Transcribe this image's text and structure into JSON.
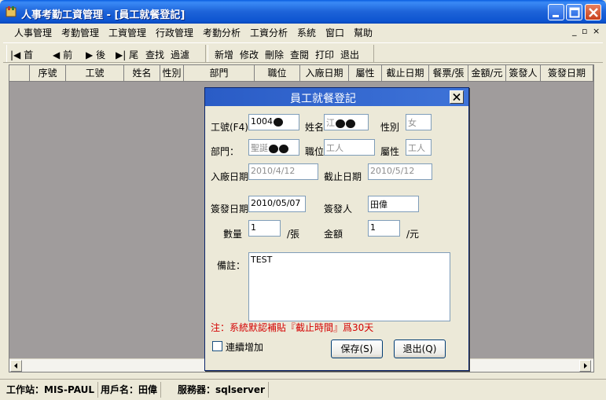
{
  "window": {
    "title": "人事考勤工資管理 - [員工就餐登記]",
    "accent": "#0a5ee0"
  },
  "menu": {
    "items": [
      "人事管理",
      "考勤管理",
      "工資管理",
      "行政管理",
      "考勤分析",
      "工資分析",
      "系統",
      "窗口",
      "幫助"
    ],
    "mdi_controls": [
      "_",
      "▫",
      "×"
    ]
  },
  "toolbar": {
    "nav": [
      "首",
      "前",
      "後",
      "尾"
    ],
    "find": "查找",
    "filter": "過濾",
    "actions": [
      "新增",
      "修改",
      "刪除",
      "查閱",
      "打印",
      "退出"
    ]
  },
  "grid": {
    "columns": [
      "序號",
      "工號",
      "姓名",
      "性別",
      "部門",
      "職位",
      "入廠日期",
      "屬性",
      "截止日期",
      "餐票/張",
      "金額/元",
      "簽發人",
      "簽發日期"
    ]
  },
  "status": {
    "workstation": "工作站：MIS-PAUL",
    "user": "用戶名：田偉",
    "server": "服務器：sqlserver"
  },
  "dialog": {
    "title": "員工就餐登記",
    "labels": {
      "emp_no": "工號(F4)",
      "name": "姓名",
      "gender": "性別",
      "dept": "部門：",
      "position": "職位",
      "attribute": "屬性",
      "hire_date": "入廠日期",
      "end_date": "截止日期",
      "issue_date": "簽發日期",
      "issuer": "簽發人",
      "quantity": "數量",
      "quantity_unit": "/張",
      "amount": "金額",
      "amount_unit": "/元",
      "remark": "備註："
    },
    "values": {
      "emp_no": "1004",
      "name": "江",
      "gender": "女",
      "dept": "聖誕",
      "position": "工人",
      "attribute": "工人",
      "hire_date": "2010/4/12",
      "end_date": "2010/5/12",
      "issue_date": "2010/05/07",
      "issuer": "田偉",
      "quantity": "1",
      "amount": "1",
      "remark": "TEST"
    },
    "note": "注：系統默認補貼『截止時間』爲30天",
    "continuous_add": "連續增加",
    "save_button": "保存(S)",
    "exit_button": "退出(Q)"
  }
}
